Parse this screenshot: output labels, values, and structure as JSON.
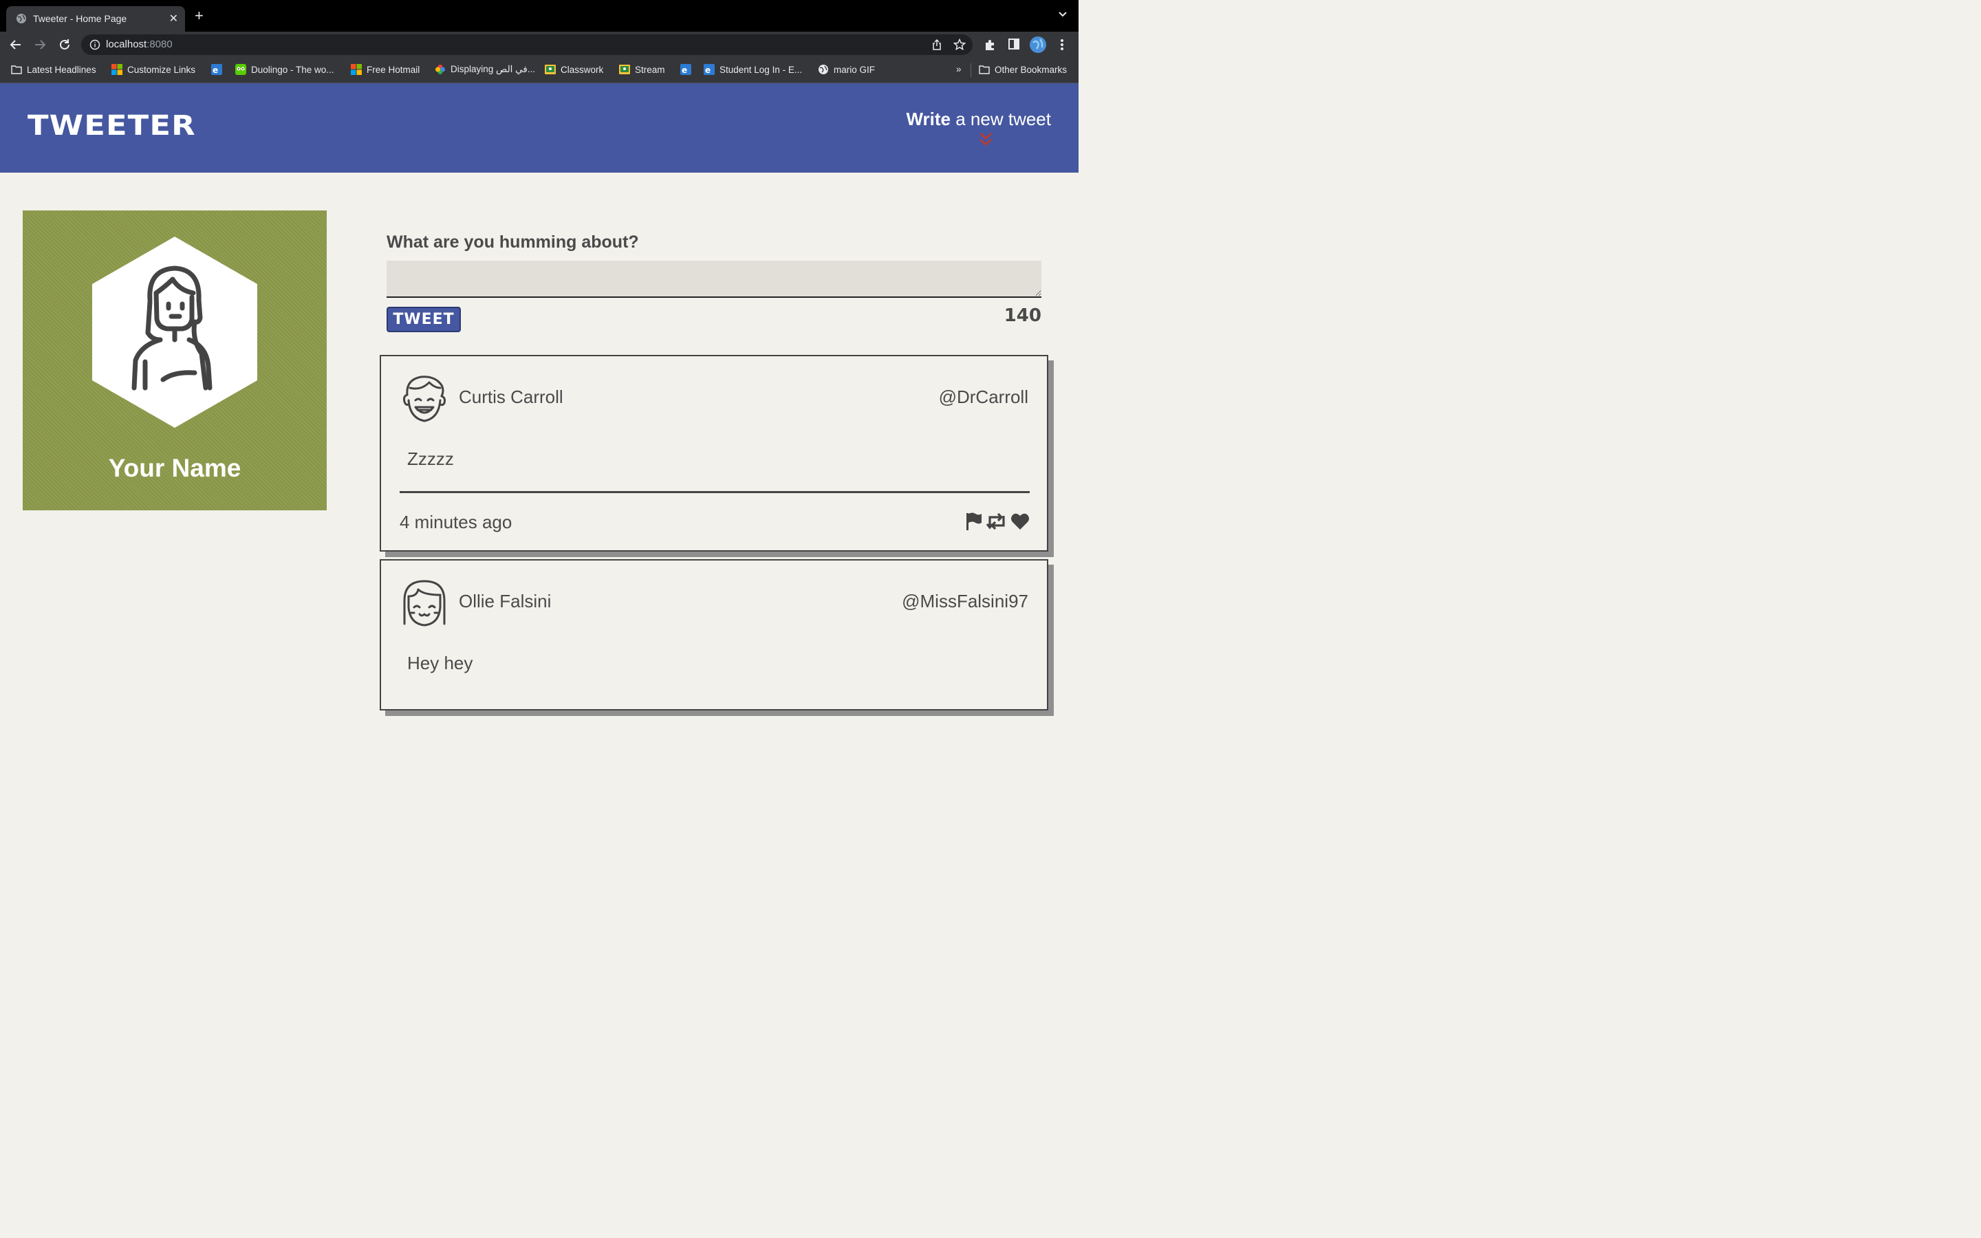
{
  "browser": {
    "tab_title": "Tweeter - Home Page",
    "url_host": "localhost",
    "url_port": ":8080",
    "bookmarks": [
      {
        "label": "Latest Headlines",
        "icon": "folder-icon"
      },
      {
        "label": "Customize Links",
        "icon": "microsoft-icon"
      },
      {
        "label": "",
        "icon": "edmodo-icon"
      },
      {
        "label": "Duolingo - The wo...",
        "icon": "duolingo-icon"
      },
      {
        "label": "Free Hotmail",
        "icon": "microsoft-icon"
      },
      {
        "label": "Displaying في الص...",
        "icon": "pinwheel-icon"
      },
      {
        "label": "Classwork",
        "icon": "classroom-icon"
      },
      {
        "label": "Stream",
        "icon": "classroom-icon"
      },
      {
        "label": "",
        "icon": "edmodo-icon"
      },
      {
        "label": "Student Log In - E...",
        "icon": "edmodo-icon"
      },
      {
        "label": "mario GIF",
        "icon": "globe-icon"
      }
    ],
    "overflow_label": "»",
    "other_bookmarks": "Other Bookmarks"
  },
  "header": {
    "logo": "TWEETER",
    "write_bold": "Write",
    "write_rest": " a new tweet"
  },
  "profile": {
    "name": "Your Name",
    "background_color": "#8c9a4a"
  },
  "compose": {
    "label": "What are you humming about?",
    "input_value": "",
    "button_label": "TWEET",
    "counter": "140"
  },
  "tweets": [
    {
      "name": "Curtis Carroll",
      "handle": "@DrCarroll",
      "content": "Zzzzz",
      "time": "4 minutes ago"
    },
    {
      "name": "Ollie Falsini",
      "handle": "@MissFalsini97",
      "content": "Hey hey"
    }
  ],
  "colors": {
    "header": "#4557a0",
    "accent": "#c0392b",
    "page_bg": "#f2f1ec"
  }
}
